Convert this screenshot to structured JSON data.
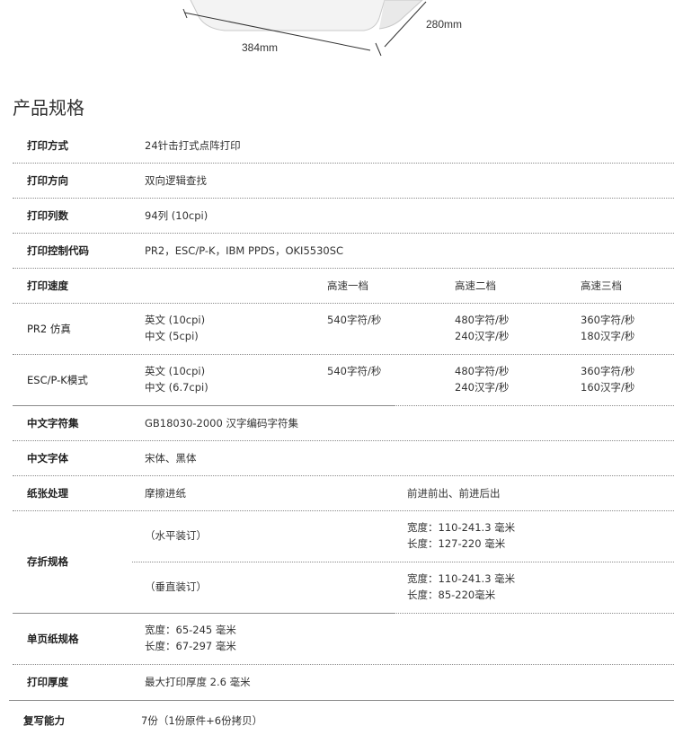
{
  "dimensions": {
    "depth": "280mm",
    "width": "384mm"
  },
  "section_title": "产品规格",
  "specs": {
    "print_method": {
      "label": "打印方式",
      "value": "24针击打式点阵打印"
    },
    "print_direction": {
      "label": "打印方向",
      "value": "双向逻辑查找"
    },
    "print_columns": {
      "label": "打印列数",
      "value": "94列 (10cpi)"
    },
    "control_codes": {
      "label": "打印控制代码",
      "value": "PR2，ESC/P-K，IBM PPDS，OKI5530SC"
    },
    "speed": {
      "label": "打印速度",
      "h1": "高速一档",
      "h2": "高速二档",
      "h3": "高速三档"
    },
    "pr2": {
      "label": "PR2 仿真",
      "lang1": "英文 (10cpi)",
      "lang2": "中文 (5cpi)",
      "s1": "540字符/秒",
      "s2a": "480字符/秒",
      "s2b": "240汉字/秒",
      "s3a": "360字符/秒",
      "s3b": "180汉字/秒"
    },
    "escpk": {
      "label": "ESC/P-K模式",
      "lang1": "英文 (10cpi)",
      "lang2": "中文 (6.7cpi)",
      "s1": "540字符/秒",
      "s2a": "480字符/秒",
      "s2b": "240汉字/秒",
      "s3a": "360字符/秒",
      "s3b": "160汉字/秒"
    },
    "charset": {
      "label": "中文字符集",
      "value": "GB18030-2000 汉字编码字符集"
    },
    "fonts": {
      "label": "中文字体",
      "value": "宋体、黑体"
    },
    "paper": {
      "label": "纸张处理",
      "v1": "摩擦进纸",
      "v2": "前进前出、前进后出"
    },
    "fanfold": {
      "label": "存折规格",
      "h_name": "（水平装订）",
      "h_w": "宽度：110-241.3 毫米",
      "h_l": "长度：127-220 毫米",
      "v_name": "（垂直装订）",
      "v_w": "宽度：110-241.3 毫米",
      "v_l": "长度：85-220毫米"
    },
    "single_sheet": {
      "label": "单页纸规格",
      "w": "宽度：65-245 毫米",
      "l": "长度：67-297 毫米"
    },
    "thickness": {
      "label": "打印厚度",
      "value": "最大打印厚度 2.6 毫米"
    },
    "copies": {
      "label": "复写能力",
      "value": "7份（1份原件+6份拷贝）"
    }
  }
}
